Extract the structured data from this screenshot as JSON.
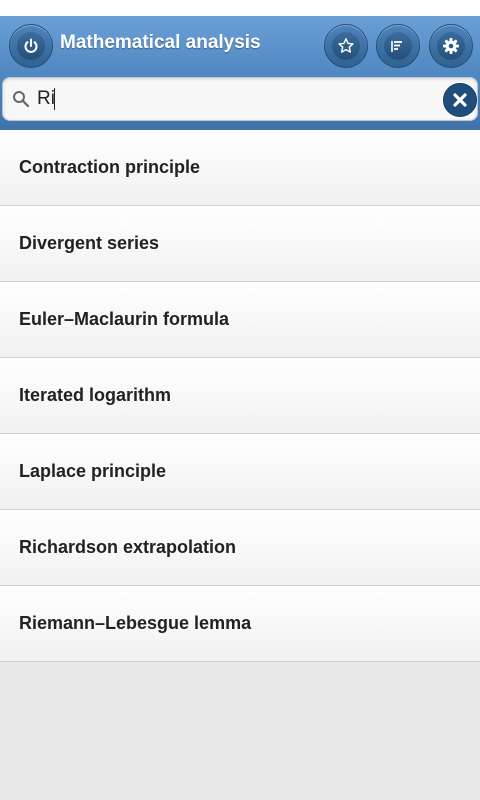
{
  "header": {
    "title": "Mathematical analysis",
    "buttons": [
      {
        "icon": "power-icon"
      },
      {
        "icon": "star-icon"
      },
      {
        "icon": "list-icon"
      },
      {
        "icon": "gear-icon"
      }
    ]
  },
  "search": {
    "value": "Ri",
    "icon": "search-icon",
    "clear_icon": "clear-icon"
  },
  "results": [
    {
      "label": "Contraction principle"
    },
    {
      "label": "Divergent series"
    },
    {
      "label": "Euler–Maclaurin formula"
    },
    {
      "label": "Iterated logarithm"
    },
    {
      "label": "Laplace principle"
    },
    {
      "label": "Richardson extrapolation"
    },
    {
      "label": "Riemann–Lebesgue lemma"
    }
  ],
  "colors": {
    "header": "#4f86c0",
    "button": "#2f628f",
    "background": "#e8e8e8"
  }
}
